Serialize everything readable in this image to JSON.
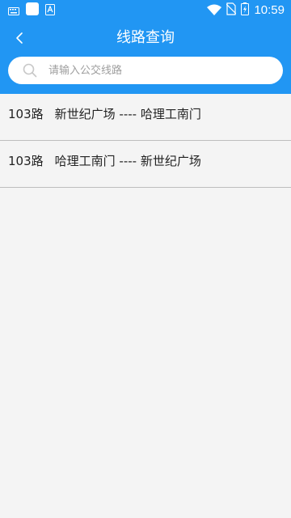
{
  "status_bar": {
    "time": "10:59",
    "icons": [
      "keyboard-icon",
      "app-square-icon",
      "store-icon",
      "wifi-icon",
      "no-sim-icon",
      "battery-charging-icon"
    ]
  },
  "header": {
    "title": "线路查询",
    "back_icon": "chevron-left-icon"
  },
  "search": {
    "placeholder": "请输入公交线路",
    "value": "",
    "icon": "search-icon"
  },
  "routes": [
    {
      "number": "103路",
      "direction": "新世纪广场 ---- 哈理工南门"
    },
    {
      "number": "103路",
      "direction": "哈理工南门 ---- 新世纪广场"
    }
  ],
  "colors": {
    "primary": "#2196f3",
    "background": "#f4f4f4",
    "divider": "#bdbdbd"
  }
}
